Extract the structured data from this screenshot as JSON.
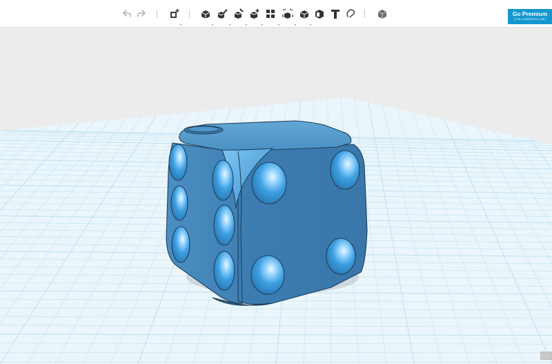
{
  "premium": {
    "title": "Go Premium",
    "subtitle": "(FOR COMMERCIAL USE)"
  },
  "toolbar": {
    "history": [
      {
        "name": "undo-icon",
        "label": "Undo"
      },
      {
        "name": "redo-icon",
        "label": "Redo"
      }
    ],
    "import": {
      "name": "import-primitive-icon",
      "label": "Primitives"
    },
    "tools": [
      {
        "name": "sketch-icon",
        "label": "Sketch"
      },
      {
        "name": "construct-icon",
        "label": "Construct"
      },
      {
        "name": "modify-icon",
        "label": "Modify"
      },
      {
        "name": "combine-icon",
        "label": "Combine"
      },
      {
        "name": "pattern-icon",
        "label": "Pattern"
      },
      {
        "name": "grouping-icon",
        "label": "Grouping"
      },
      {
        "name": "snap-icon",
        "label": "Snap"
      },
      {
        "name": "measure-icon",
        "label": "Measure"
      },
      {
        "name": "text-icon",
        "label": "Text"
      },
      {
        "name": "support-icon",
        "label": "Support"
      }
    ],
    "material": {
      "name": "material-icon",
      "label": "Material"
    }
  },
  "colors": {
    "accent": "#1497cd",
    "model": "#4f93c6",
    "grid_line": "#bfe0f0",
    "grid_background": "#eaf6fb",
    "canvas": "#ececec"
  }
}
